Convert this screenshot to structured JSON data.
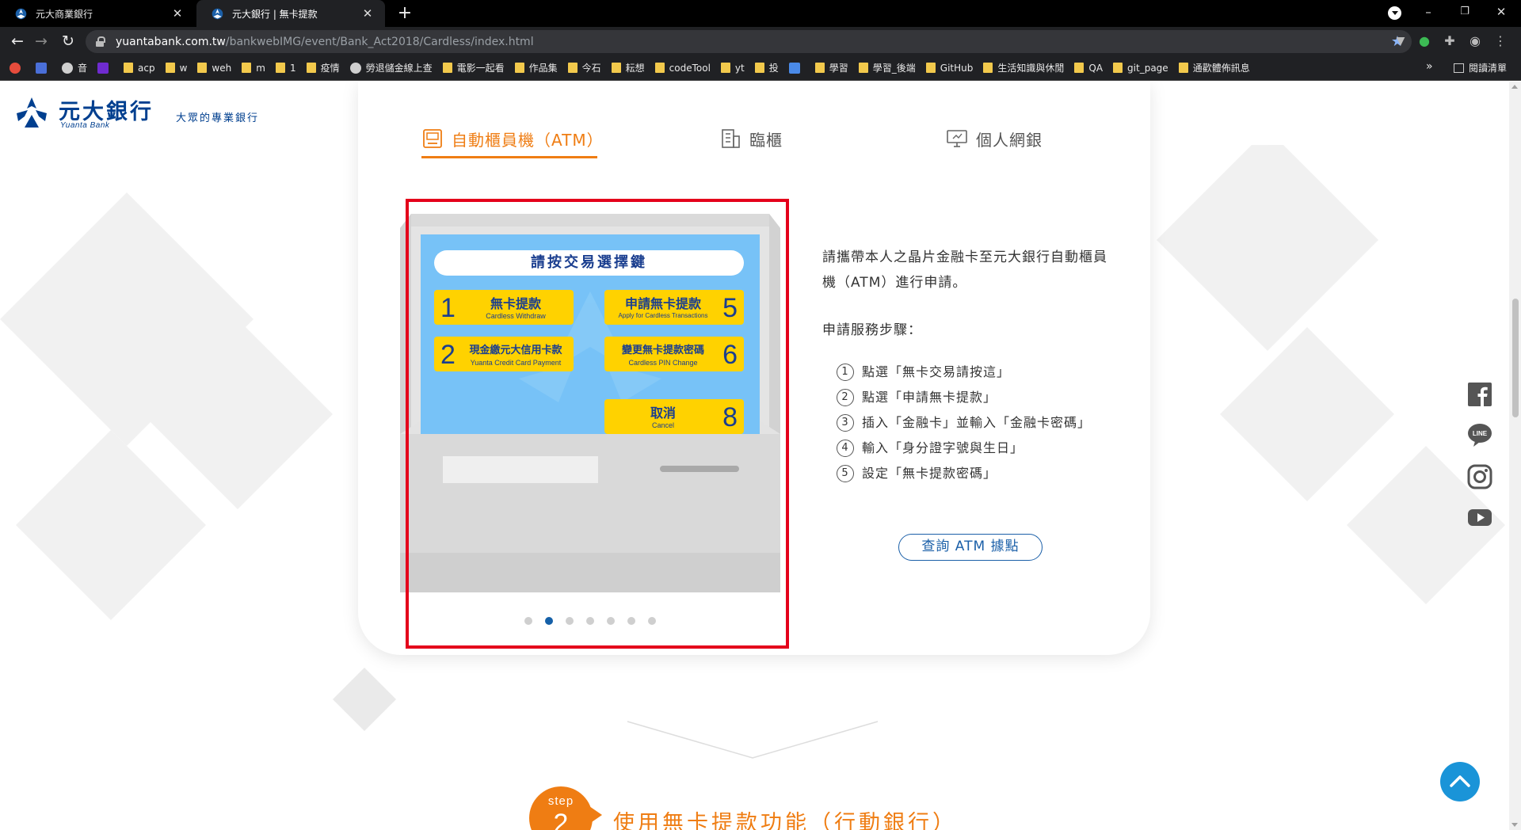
{
  "browser": {
    "tabs": [
      {
        "title": "元大商業銀行",
        "active": false
      },
      {
        "title": "元大銀行 | 無卡提款",
        "active": true
      }
    ],
    "new_tab": "+",
    "url_host": "yuantabank.com.tw",
    "url_path": "/bankwebIMG/event/Bank_Act2018/Cardless/index.html",
    "window_controls": {
      "minimize": "–",
      "restore": "❐",
      "close": "✕"
    },
    "bookmarks": [
      {
        "label": "",
        "icon": "red-circle-icon",
        "color": "#e74c3c"
      },
      {
        "label": "",
        "icon": "blue-book-icon",
        "color": "#4a6fd8"
      },
      {
        "label": "音",
        "icon": "globe-icon",
        "color": "#cfcfcf"
      },
      {
        "label": "",
        "icon": "yahoo-icon",
        "color": "#6f2bd0"
      },
      {
        "label": "acp",
        "icon": "folder-icon",
        "color": "#f2c94c"
      },
      {
        "label": "w",
        "icon": "folder-icon",
        "color": "#f2c94c"
      },
      {
        "label": "weh",
        "icon": "folder-icon",
        "color": "#f2c94c"
      },
      {
        "label": "m",
        "icon": "folder-icon",
        "color": "#f2c94c"
      },
      {
        "label": "1",
        "icon": "folder-icon",
        "color": "#f2c94c"
      },
      {
        "label": "疫情",
        "icon": "folder-icon",
        "color": "#f2c94c"
      },
      {
        "label": "勞退儲金線上查",
        "icon": "globe-icon",
        "color": "#cfcfcf"
      },
      {
        "label": "電影一起看",
        "icon": "folder-icon",
        "color": "#f2c94c"
      },
      {
        "label": "作品集",
        "icon": "folder-icon",
        "color": "#f2c94c"
      },
      {
        "label": "今石",
        "icon": "folder-icon",
        "color": "#f2c94c"
      },
      {
        "label": "耘想",
        "icon": "folder-icon",
        "color": "#f2c94c"
      },
      {
        "label": "codeTool",
        "icon": "folder-icon",
        "color": "#f2c94c"
      },
      {
        "label": "yt",
        "icon": "folder-icon",
        "color": "#f2c94c"
      },
      {
        "label": "投",
        "icon": "folder-icon",
        "color": "#f2c94c"
      },
      {
        "label": "",
        "icon": "translate-icon",
        "color": "#4a8ae8"
      },
      {
        "label": "學習",
        "icon": "folder-icon",
        "color": "#f2c94c"
      },
      {
        "label": "學習_後端",
        "icon": "folder-icon",
        "color": "#f2c94c"
      },
      {
        "label": "GitHub",
        "icon": "folder-icon",
        "color": "#f2c94c"
      },
      {
        "label": "生活知識與休閒",
        "icon": "folder-icon",
        "color": "#f2c94c"
      },
      {
        "label": "QA",
        "icon": "folder-icon",
        "color": "#f2c94c"
      },
      {
        "label": "git_page",
        "icon": "folder-icon",
        "color": "#f2c94c"
      },
      {
        "label": "通歡體佈訊息",
        "icon": "folder-icon",
        "color": "#f2c94c"
      }
    ],
    "bookmarks_more": "»",
    "reading_list": "閱讀清單"
  },
  "site": {
    "logo_name": "元大銀行",
    "logo_en": "Yuanta Bank",
    "slogan": "大眾的專業銀行",
    "brand_color": "#003f8f",
    "accent_color": "#ef7d13"
  },
  "tabs": {
    "atm": "自動櫃員機（ATM）",
    "counter": "臨櫃",
    "online": "個人網銀"
  },
  "atm_screen": {
    "title": "請按交易選擇鍵",
    "buttons": [
      {
        "num": "1",
        "zh": "無卡提款",
        "en": "Cardless Withdraw"
      },
      {
        "num": "2",
        "zh": "現金繳元大信用卡款",
        "en": "Yuanta Credit Card Payment"
      },
      {
        "num": "5",
        "zh": "申請無卡提款",
        "en": "Apply for Cardless Transactions"
      },
      {
        "num": "6",
        "zh": "變更無卡提款密碼",
        "en": "Cardless PIN Change"
      },
      {
        "num": "8",
        "zh": "取消",
        "en": "Cancel"
      }
    ]
  },
  "carousel": {
    "dot_count": 7,
    "active_index": 1
  },
  "description": "請攜帶本人之晶片金融卡至元大銀行自動櫃員機（ATM）進行申請。",
  "steps_title": "申請服務步驟：",
  "steps": [
    {
      "num": "1",
      "text": "點選「無卡交易請按這」"
    },
    {
      "num": "2",
      "text": "點選「申請無卡提款」"
    },
    {
      "num": "3",
      "text": "插入「金融卡」並輸入「金融卡密碼」"
    },
    {
      "num": "4",
      "text": "輸入「身分證字號與生日」"
    },
    {
      "num": "5",
      "text": "設定「無卡提款密碼」"
    }
  ],
  "atm_location_button": "查詢 ATM 據點",
  "social": [
    "facebook-icon",
    "line-icon",
    "instagram-icon",
    "youtube-icon"
  ],
  "step2": {
    "label": "step",
    "number": "2",
    "title": "使用無卡提款功能（行動銀行）"
  }
}
